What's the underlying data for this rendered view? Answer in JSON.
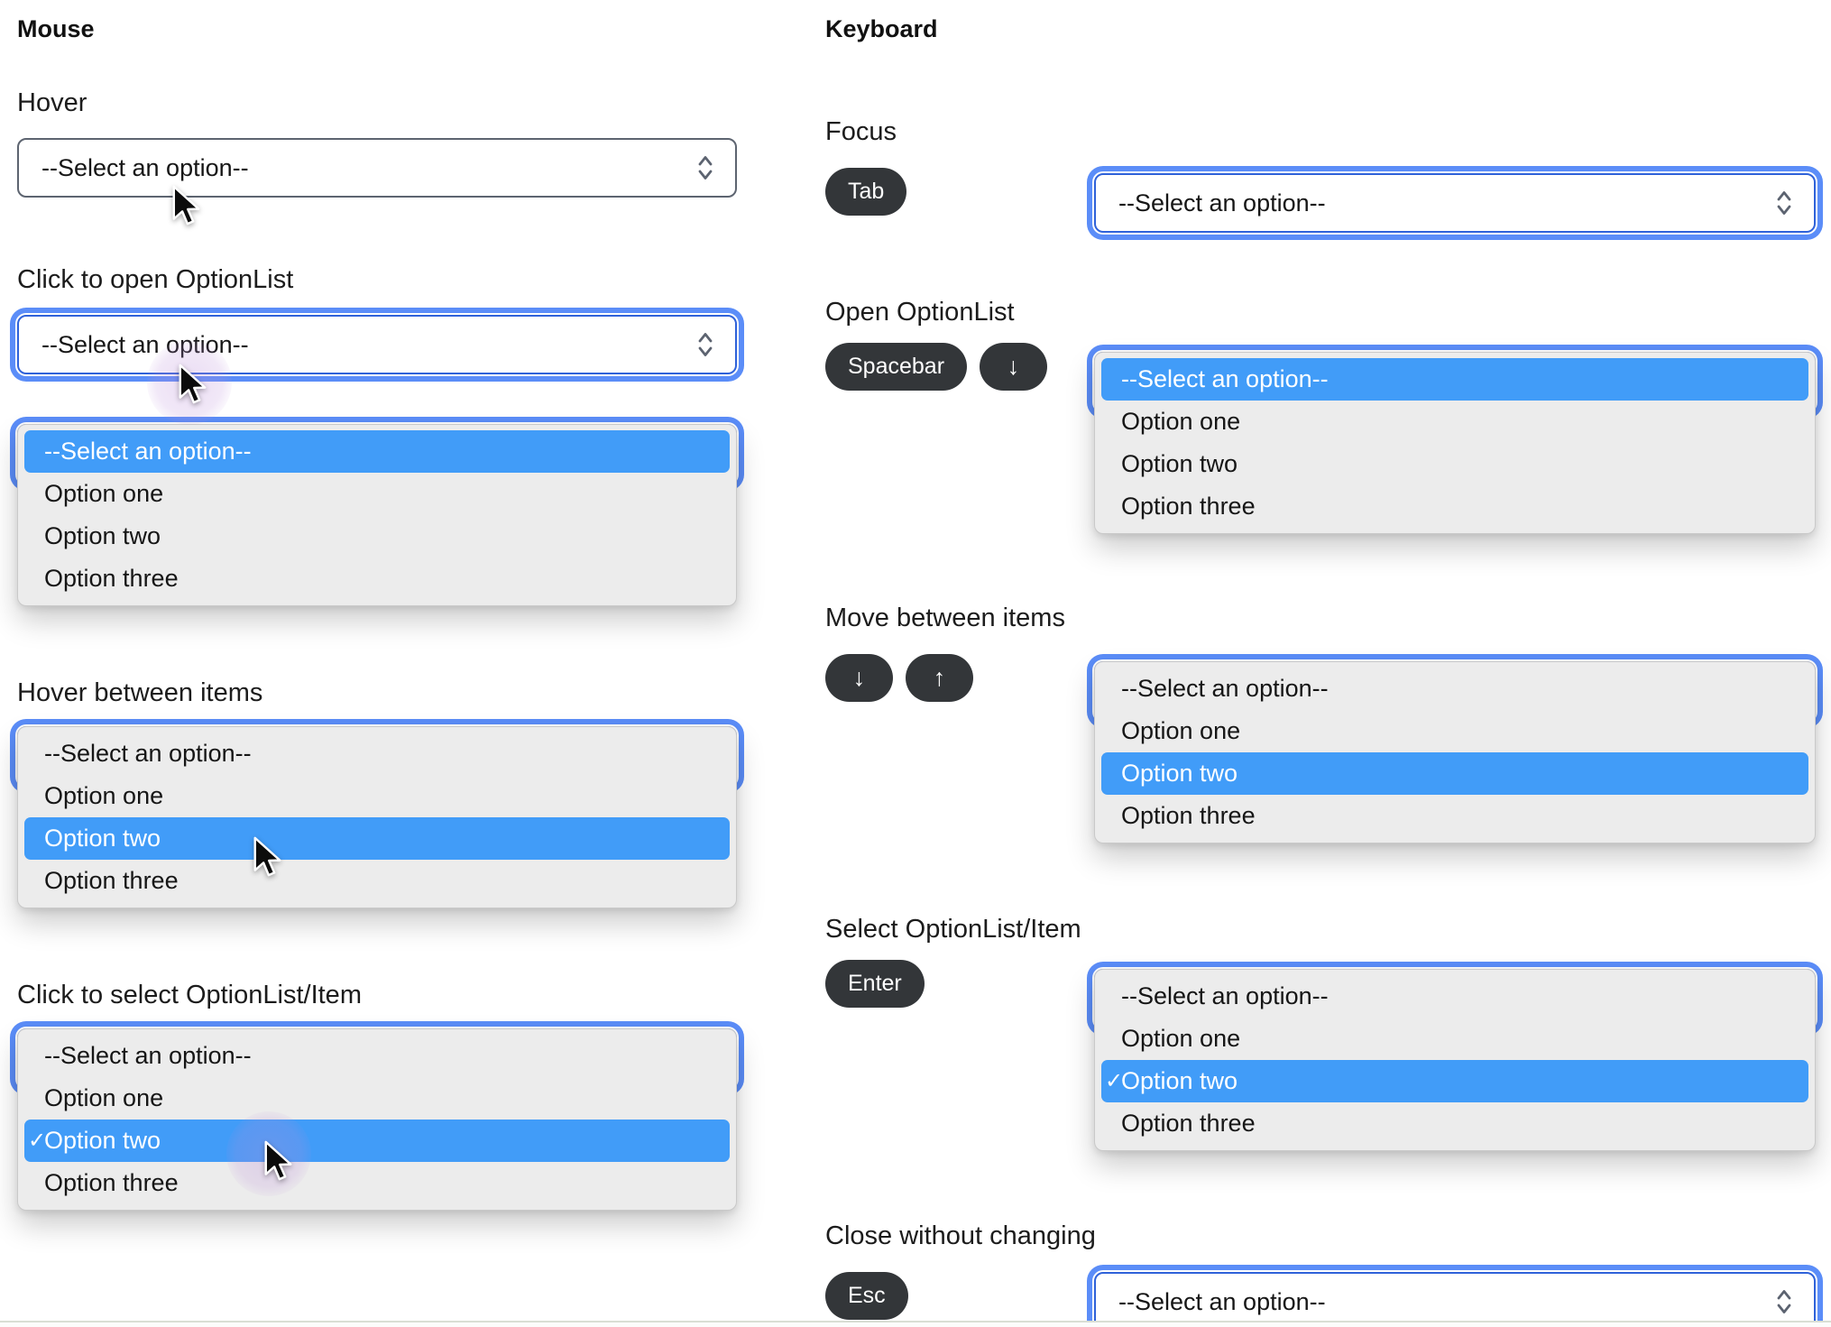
{
  "select": {
    "placeholder": "--Select an option--",
    "options": [
      "--Select an option--",
      "Option one",
      "Option two",
      "Option three"
    ]
  },
  "mouse": {
    "title": "Mouse",
    "sections": {
      "hover": {
        "label": "Hover"
      },
      "open": {
        "label": "Click to open OptionList"
      },
      "hover_items": {
        "label": "Hover between items"
      },
      "select_item": {
        "label": "Click to select OptionList/Item"
      }
    }
  },
  "keyboard": {
    "title": "Keyboard",
    "sections": {
      "focus": {
        "label": "Focus",
        "keys": {
          "tab": "Tab"
        }
      },
      "open": {
        "label": "Open OptionList",
        "keys": {
          "spacebar": "Spacebar",
          "down": "↓"
        }
      },
      "move": {
        "label": "Move between items",
        "keys": {
          "down": "↓",
          "up": "↑"
        }
      },
      "select": {
        "label": "Select OptionList/Item",
        "keys": {
          "enter": "Enter"
        }
      },
      "close": {
        "label": "Close without changing",
        "keys": {
          "esc": "Esc"
        }
      }
    }
  },
  "icons": {
    "check": "✓",
    "stepper": "up-down-chevrons",
    "cursor": "arrow-cursor"
  },
  "colors": {
    "focus_ring": "#5b8df8",
    "focus_border": "#2f62d9",
    "select_border": "#5d6470",
    "highlight": "#419cf8",
    "list_bg": "#ececec",
    "key_bg": "#333639",
    "halo": "rgba(186,140,217,0.25)"
  }
}
